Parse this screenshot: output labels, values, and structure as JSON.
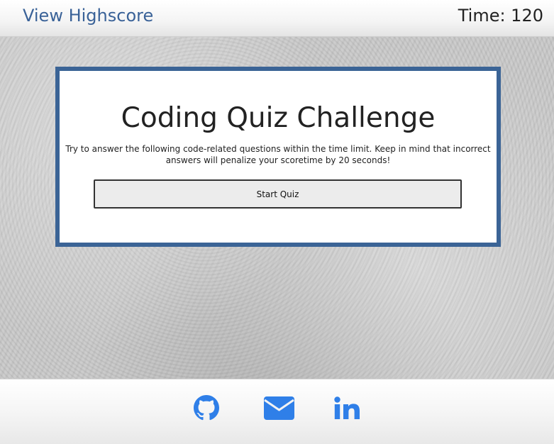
{
  "header": {
    "highscore_label": "View Highscore",
    "timer_text": "Time: 120"
  },
  "quiz_card": {
    "title": "Coding Quiz Challenge",
    "description": "Try to answer the following code-related questions within the time limit. Keep in mind that incorrect answers will penalize your scoretime by 20 seconds!",
    "start_button_label": "Start Quiz"
  },
  "footer": {
    "links": [
      {
        "icon": "github-icon"
      },
      {
        "icon": "envelope-icon"
      },
      {
        "icon": "linkedin-icon"
      }
    ]
  },
  "colors": {
    "link_blue": "#3a6298",
    "card_border": "#3b6496",
    "icon_blue": "#2f7fe8"
  }
}
